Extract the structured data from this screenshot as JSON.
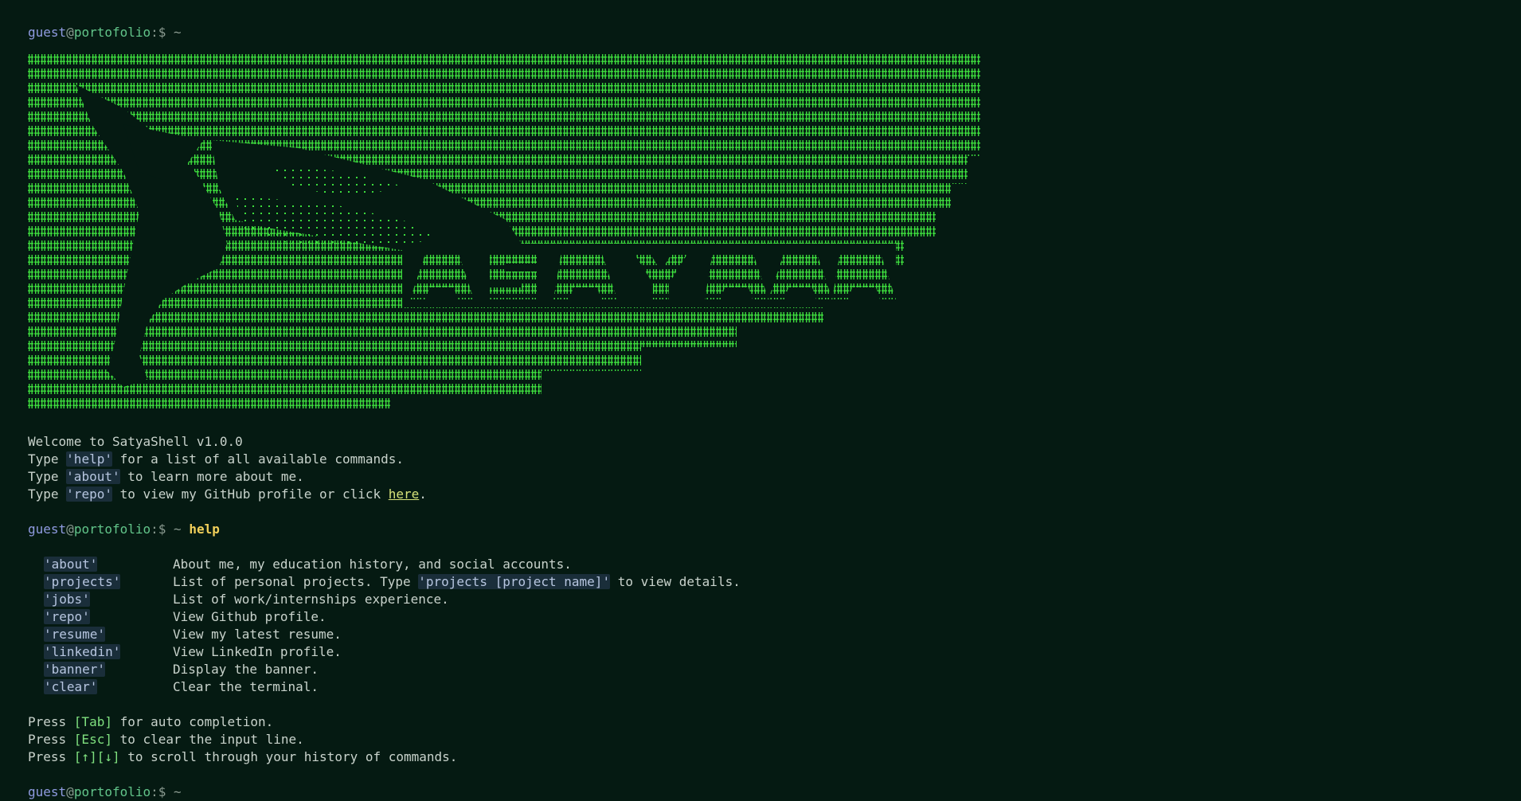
{
  "prompt": {
    "user": "guest",
    "at": "@",
    "host": "portofolio",
    "sep": ":$ ~"
  },
  "banner": {
    "description_icon": "ascii-art-banner-icon",
    "color": "#3ddc3d"
  },
  "welcome": {
    "line1": "Welcome to SatyaShell v1.0.0",
    "help_pre": "Type ",
    "help_kw": "'help'",
    "help_post": " for a list of all available commands.",
    "about_pre": "Type ",
    "about_kw": "'about'",
    "about_post": " to learn more about me.",
    "repo_pre": "Type ",
    "repo_kw": "'repo'",
    "repo_mid": " to view my GitHub profile or click ",
    "repo_link": "here",
    "repo_end": "."
  },
  "history_command": "help",
  "help": {
    "items": [
      {
        "cmd": "'about'",
        "desc": "About me, my education history, and social accounts."
      },
      {
        "cmd": "'projects'",
        "desc_pre": "List of personal projects. Type ",
        "desc_kw": "'projects [project name]'",
        "desc_post": " to view details."
      },
      {
        "cmd": "'jobs'",
        "desc": "List of work/internships experience."
      },
      {
        "cmd": "'repo'",
        "desc": "View Github profile."
      },
      {
        "cmd": "'resume'",
        "desc": "View my latest resume."
      },
      {
        "cmd": "'linkedin'",
        "desc": "View LinkedIn profile."
      },
      {
        "cmd": "'banner'",
        "desc": "Display the banner."
      },
      {
        "cmd": "'clear'",
        "desc": "Clear the terminal."
      }
    ]
  },
  "tips": {
    "tab_pre": "Press ",
    "tab_key": "[Tab]",
    "tab_post": " for auto completion.",
    "esc_pre": "Press ",
    "esc_key": "[Esc]",
    "esc_post": " to clear the input line.",
    "arrows_pre": "Press ",
    "arrows_key": "[↑][↓]",
    "arrows_post": " to scroll through your history of commands."
  },
  "colors": {
    "background": "#051a12",
    "ascii_green": "#3ddc3d",
    "command_yellow": "#f1cf5a"
  }
}
